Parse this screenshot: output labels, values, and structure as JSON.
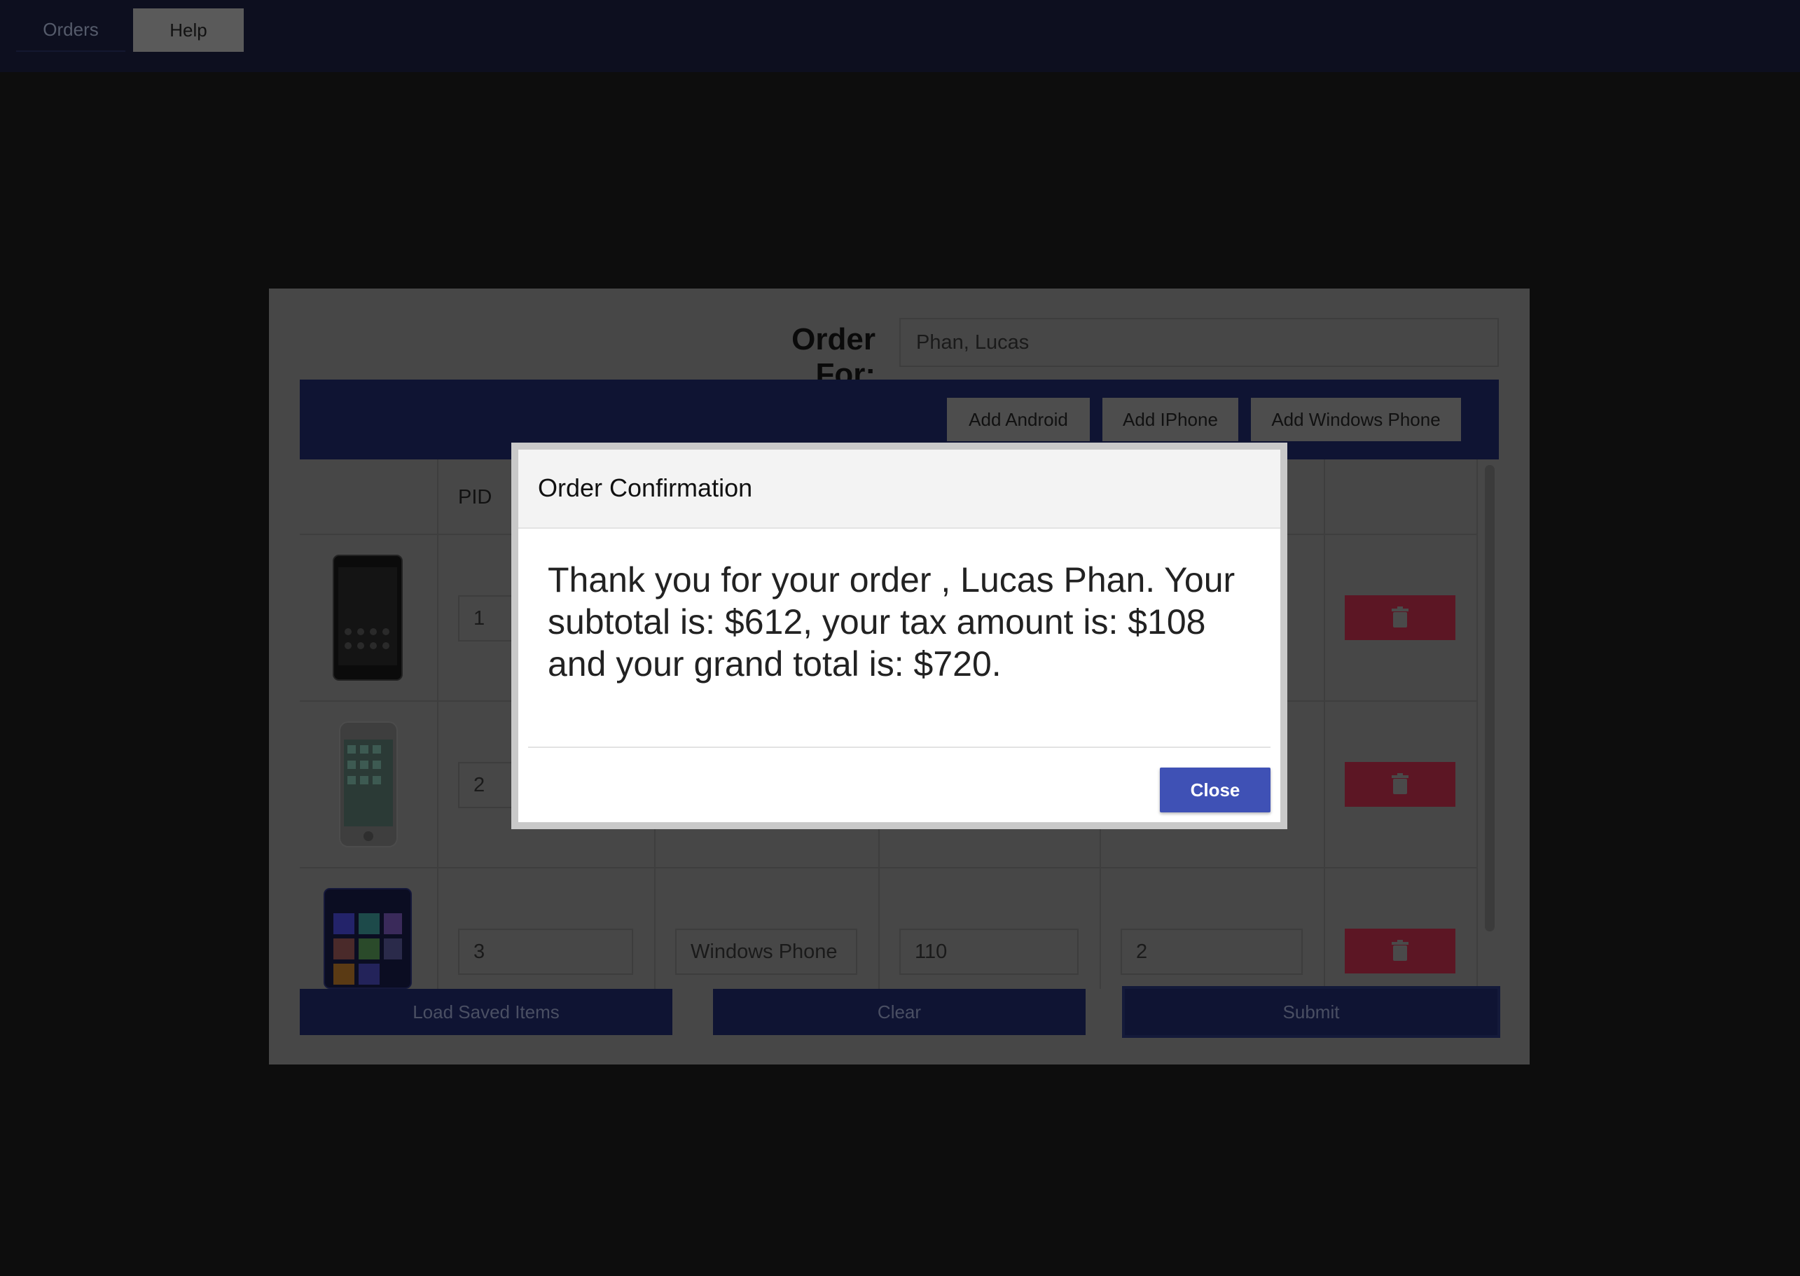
{
  "nav": {
    "tabs": [
      {
        "label": "Orders"
      },
      {
        "label": "Help"
      }
    ]
  },
  "order": {
    "order_for_label": "Order For:",
    "customer_value": "Phan, Lucas",
    "toolbar": {
      "add_android": "Add Android",
      "add_iphone": "Add IPhone",
      "add_windows_phone": "Add Windows Phone"
    },
    "columns": {
      "pid": "PID"
    },
    "rows": [
      {
        "pid": "1",
        "phone_icon": "android-phone-icon"
      },
      {
        "pid": "2",
        "phone_icon": "iphone-icon"
      },
      {
        "pid": "3",
        "name": "Windows Phone",
        "price": "110",
        "quantity": "2",
        "phone_icon": "windows-phone-icon"
      }
    ],
    "actions": {
      "load_saved": "Load Saved Items",
      "clear": "Clear",
      "submit": "Submit"
    }
  },
  "modal": {
    "title": "Order Confirmation",
    "message": "Thank you for your order , Lucas Phan. Your subtotal is: $612, your tax amount is: $108 and your grand total is: $720.",
    "close_label": "Close"
  },
  "colors": {
    "accent": "#3f51b5",
    "nav_bg": "#0d0f1f",
    "delete_red": "#c2185b"
  }
}
